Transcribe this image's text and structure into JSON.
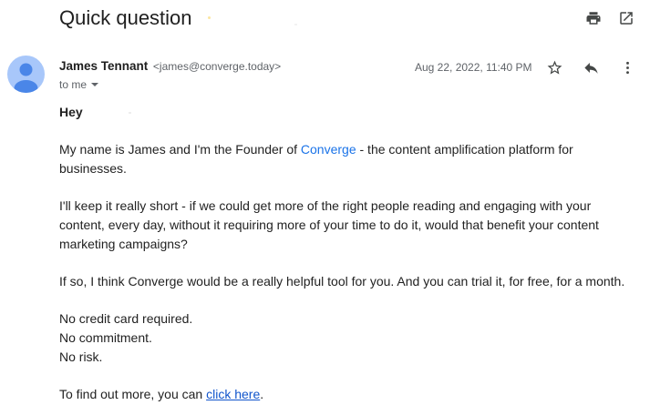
{
  "email": {
    "subject": "Quick question",
    "sender": {
      "name": "James Tennant",
      "email": "<james@converge.today>"
    },
    "recipient": "to me",
    "date": "Aug 22, 2022, 11:40 PM",
    "icons": {
      "print": "print-icon",
      "open_new_window": "open-in-new-window-icon",
      "star": "star-icon",
      "reply": "reply-icon",
      "more": "more-vertical-icon",
      "dropdown": "chevron-down-icon",
      "avatar": "avatar-icon"
    },
    "body": {
      "greeting": "Hey",
      "p1_before": "My name is James and I'm the Founder of ",
      "p1_link": "Converge",
      "p1_after": " - the content amplification platform for businesses.",
      "p2": "I'll keep it really short - if we could get more of the right people reading and engaging with your content, every day, without it requiring more of your time to do it, would that benefit your content marketing campaigns?",
      "p3": "If so, I think Converge would be a really helpful tool for you. And you can trial it, for free, for a month.",
      "line1": "No credit card required.",
      "line2": "No commitment.",
      "line3": "No risk.",
      "p5_before": "To find out more, you can ",
      "p5_link": "click here",
      "p5_after": "."
    }
  },
  "colors": {
    "avatar_bg": "#a8c7fa",
    "avatar_fg": "#4a86e8",
    "link": "#1a73e8",
    "secondary_text": "#5f6368"
  }
}
